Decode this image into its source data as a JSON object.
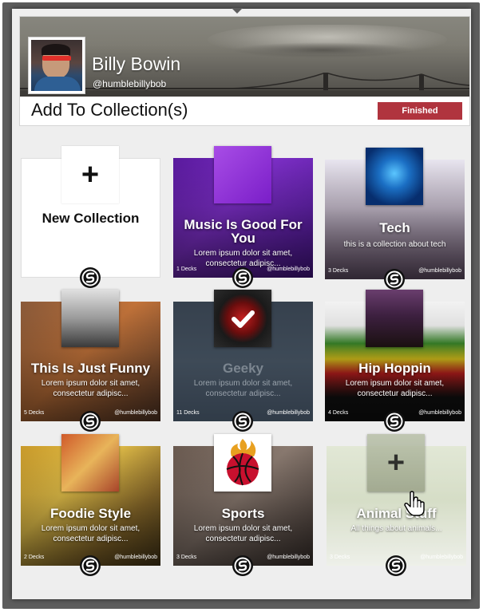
{
  "profile": {
    "name": "Billy Bowin",
    "handle": "@humblebillybob"
  },
  "dialog": {
    "title": "Add To Collection(s)",
    "finished_label": "Finished"
  },
  "new_collection": {
    "label": "New Collection",
    "icon": "plus-icon"
  },
  "collections": [
    {
      "title": "Music Is Good For You",
      "description": "Lorem ipsum dolor sit amet, consectetur adipisc...",
      "decks": "1 Decks",
      "owner": "@humblebillybob",
      "state": "normal"
    },
    {
      "title": "Tech",
      "description": "this is a collection about tech",
      "decks": "3 Decks",
      "owner": "@humblebillybob",
      "state": "normal"
    },
    {
      "title": "This Is Just Funny",
      "description": "Lorem ipsum dolor sit amet, consectetur adipisc...",
      "decks": "5 Decks",
      "owner": "@humblebillybob",
      "state": "normal"
    },
    {
      "title": "Geeky",
      "description": "Lorem ipsum dolor sit amet, consectetur adipisc...",
      "decks": "11 Decks",
      "owner": "@humblebillybob",
      "state": "selected"
    },
    {
      "title": "Hip Hoppin",
      "description": "Lorem ipsum dolor sit amet, consectetur adipisc...",
      "decks": "4 Decks",
      "owner": "@humblebillybob",
      "state": "normal"
    },
    {
      "title": "Foodie Style",
      "description": "Lorem ipsum dolor sit amet, consectetur adipisc...",
      "decks": "2 Decks",
      "owner": "@humblebillybob",
      "state": "normal"
    },
    {
      "title": "Sports",
      "description": "Lorem ipsum dolor sit amet, consectetur adipisc...",
      "decks": "3 Decks",
      "owner": "@humblebillybob",
      "state": "normal"
    },
    {
      "title": "Animal Stuff",
      "description": "All things about animals...",
      "decks": "3 Decks",
      "owner": "@humblebillybob",
      "state": "hover"
    }
  ],
  "colors": {
    "finished_button": "#b0343e",
    "panel_background": "#eeeeee",
    "frame": "#5d5d5d"
  },
  "icons": {
    "card_logo": "brand-logo-icon",
    "selected": "checkmark-icon",
    "add": "plus-icon",
    "cursor": "hand-pointer-icon"
  }
}
